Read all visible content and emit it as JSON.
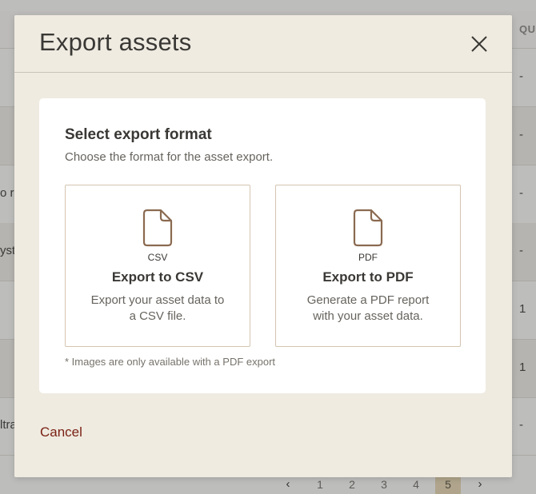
{
  "background": {
    "table_header_partial": "QU",
    "rows": [
      {
        "left": "",
        "right": "-"
      },
      {
        "left": "",
        "right": "-"
      },
      {
        "left": "o re",
        "right": "-"
      },
      {
        "left": "yst",
        "right": "-"
      },
      {
        "left": "",
        "right": "1"
      },
      {
        "left": "",
        "right": "1"
      },
      {
        "left": "ltra",
        "right": "-"
      }
    ],
    "pagination": {
      "prev_icon": "chevron-left-icon",
      "pages": [
        "1",
        "2",
        "3",
        "4",
        "5"
      ],
      "current_page": "5",
      "next_icon": "chevron-right-icon"
    }
  },
  "modal": {
    "title": "Export assets",
    "close_icon": "close-icon",
    "card": {
      "heading": "Select export format",
      "subheading": "Choose the format for the asset export.",
      "options": [
        {
          "icon": "document-icon",
          "ext": "CSV",
          "title": "Export to CSV",
          "description": "Export your asset data to a CSV file."
        },
        {
          "icon": "document-icon",
          "ext": "PDF",
          "title": "Export to PDF",
          "description": "Generate a PDF report with your asset data."
        }
      ],
      "footnote": "* Images are only available with a PDF export"
    },
    "cancel_label": "Cancel"
  },
  "colors": {
    "modal_bg": "#efebe1",
    "accent_border": "#d5c4b0",
    "icon_stroke": "#8a6a50",
    "cancel_text": "#7a1f13"
  }
}
